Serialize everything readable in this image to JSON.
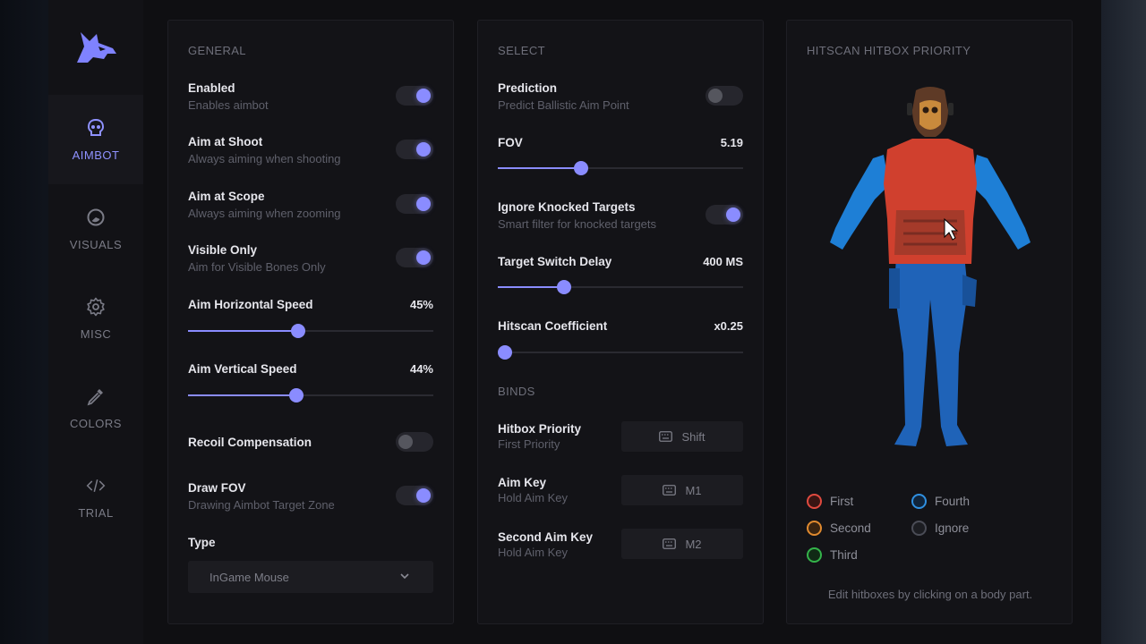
{
  "nav": [
    {
      "label": "AIMBOT",
      "icon": "skull-icon",
      "active": true
    },
    {
      "label": "VISUALS",
      "icon": "eye-icon",
      "active": false
    },
    {
      "label": "MISC",
      "icon": "gear-icon",
      "active": false
    },
    {
      "label": "COLORS",
      "icon": "eyedropper-icon",
      "active": false
    },
    {
      "label": "TRIAL",
      "icon": "code-icon",
      "active": false
    }
  ],
  "general": {
    "title": "GENERAL",
    "enabled": {
      "title": "Enabled",
      "subtitle": "Enables aimbot",
      "on": true
    },
    "aim_at_shoot": {
      "title": "Aim at Shoot",
      "subtitle": "Always aiming when shooting",
      "on": true
    },
    "aim_at_scope": {
      "title": "Aim at Scope",
      "subtitle": "Always aiming when zooming",
      "on": true
    },
    "visible_only": {
      "title": "Visible Only",
      "subtitle": "Aim for Visible Bones Only",
      "on": true
    },
    "horizontal_speed": {
      "title": "Aim Horizontal Speed",
      "value": "45%",
      "level": 0.45
    },
    "vertical_speed": {
      "title": "Aim Vertical Speed",
      "value": "44%",
      "level": 0.44
    },
    "recoil": {
      "title": "Recoil Compensation",
      "on": false
    },
    "draw_fov": {
      "title": "Draw FOV",
      "subtitle": "Drawing Aimbot Target Zone",
      "on": true
    },
    "type": {
      "title": "Type",
      "value": "InGame Mouse"
    }
  },
  "select": {
    "title": "SELECT",
    "prediction": {
      "title": "Prediction",
      "subtitle": "Predict Ballistic Aim Point",
      "on": false
    },
    "fov": {
      "title": "FOV",
      "value": "5.19",
      "level": 0.34
    },
    "ignore_knocked": {
      "title": "Ignore Knocked Targets",
      "subtitle": "Smart filter for knocked targets",
      "on": true
    },
    "switch_delay": {
      "title": "Target Switch Delay",
      "value": "400 MS",
      "level": 0.27
    },
    "hitscan_coeff": {
      "title": "Hitscan Coefficient",
      "value": "x0.25",
      "level": 0.0
    }
  },
  "binds": {
    "title": "BINDS",
    "hitbox_priority": {
      "title": "Hitbox Priority",
      "subtitle": "First Priority",
      "key": "Shift"
    },
    "aim_key": {
      "title": "Aim Key",
      "subtitle": "Hold Aim Key",
      "key": "M1"
    },
    "second_aim_key": {
      "title": "Second Aim Key",
      "subtitle": "Hold Aim Key",
      "key": "M2"
    }
  },
  "hitbox": {
    "title": "HITSCAN HITBOX PRIORITY",
    "legend": [
      {
        "label": "First",
        "color": "#e04a3f"
      },
      {
        "label": "Second",
        "color": "#e08a2f"
      },
      {
        "label": "Third",
        "color": "#34b34a"
      },
      {
        "label": "Fourth",
        "color": "#2f8fe0"
      },
      {
        "label": "Ignore",
        "color": "#4a4c56"
      }
    ],
    "hint": "Edit hitboxes by clicking on a body part."
  },
  "colors": {
    "accent": "#8a8cff",
    "head": "#c98a3c",
    "torso": "#d0402e",
    "arms": "#1e7fd6",
    "legs": "#1f63b8"
  }
}
